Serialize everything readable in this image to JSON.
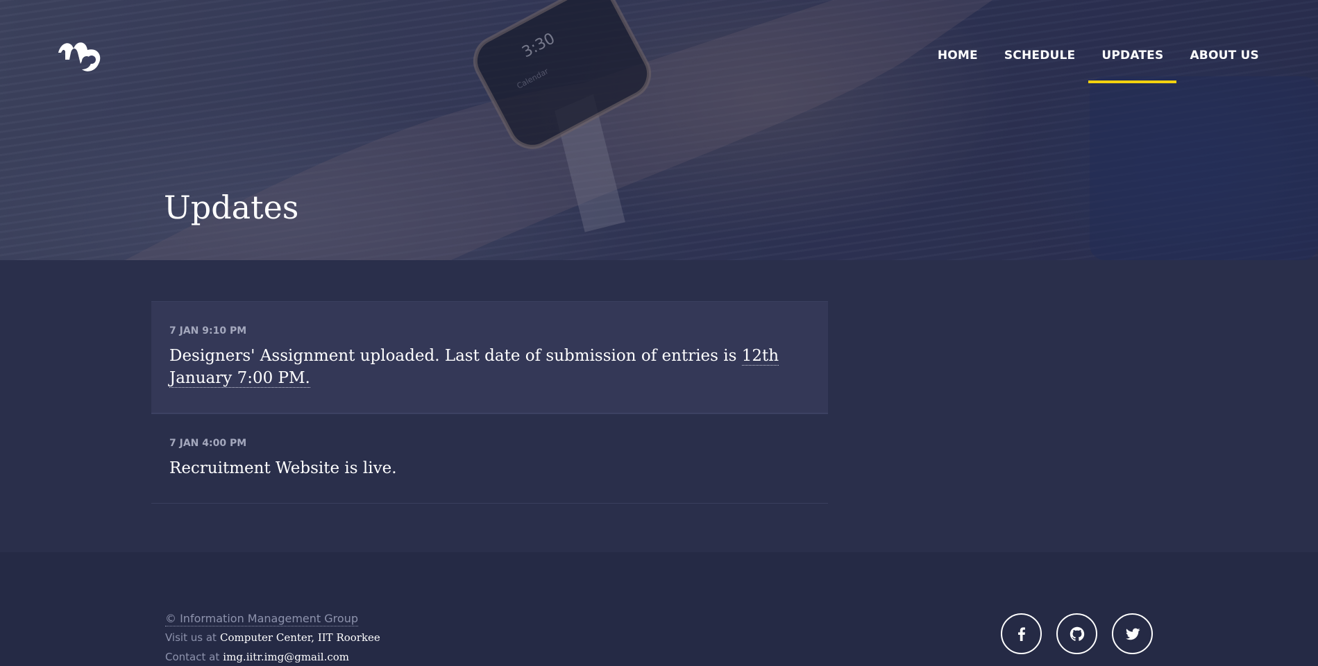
{
  "nav": {
    "items": [
      {
        "label": "HOME",
        "active": false
      },
      {
        "label": "SCHEDULE",
        "active": false
      },
      {
        "label": "UPDATES",
        "active": true
      },
      {
        "label": "ABOUT US",
        "active": false
      }
    ],
    "active_color": "#f3d20f"
  },
  "hero": {
    "title": "Updates"
  },
  "updates": [
    {
      "time": "7 JAN 9:10 PM",
      "text": "Designers' Assignment uploaded. Last date of submission of entries is ",
      "deadline": "12th January 7:00 PM.",
      "highlighted": true
    },
    {
      "time": "7 JAN 4:00 PM",
      "text": "Recruitment Website is live.",
      "deadline": "",
      "highlighted": false
    }
  ],
  "footer": {
    "copyright": "© Information Management Group",
    "visit_prefix": "Visit us at",
    "visit_place": "Computer Center, IIT Roorkee",
    "contact_prefix": "Contact at",
    "contact_email": "img.iitr.img@gmail.com",
    "social": [
      {
        "name": "facebook-icon"
      },
      {
        "name": "github-icon"
      },
      {
        "name": "twitter-icon"
      }
    ]
  },
  "colors": {
    "background": "#2a2f4b",
    "footer": "#252a45",
    "accent": "#f3d20f"
  }
}
